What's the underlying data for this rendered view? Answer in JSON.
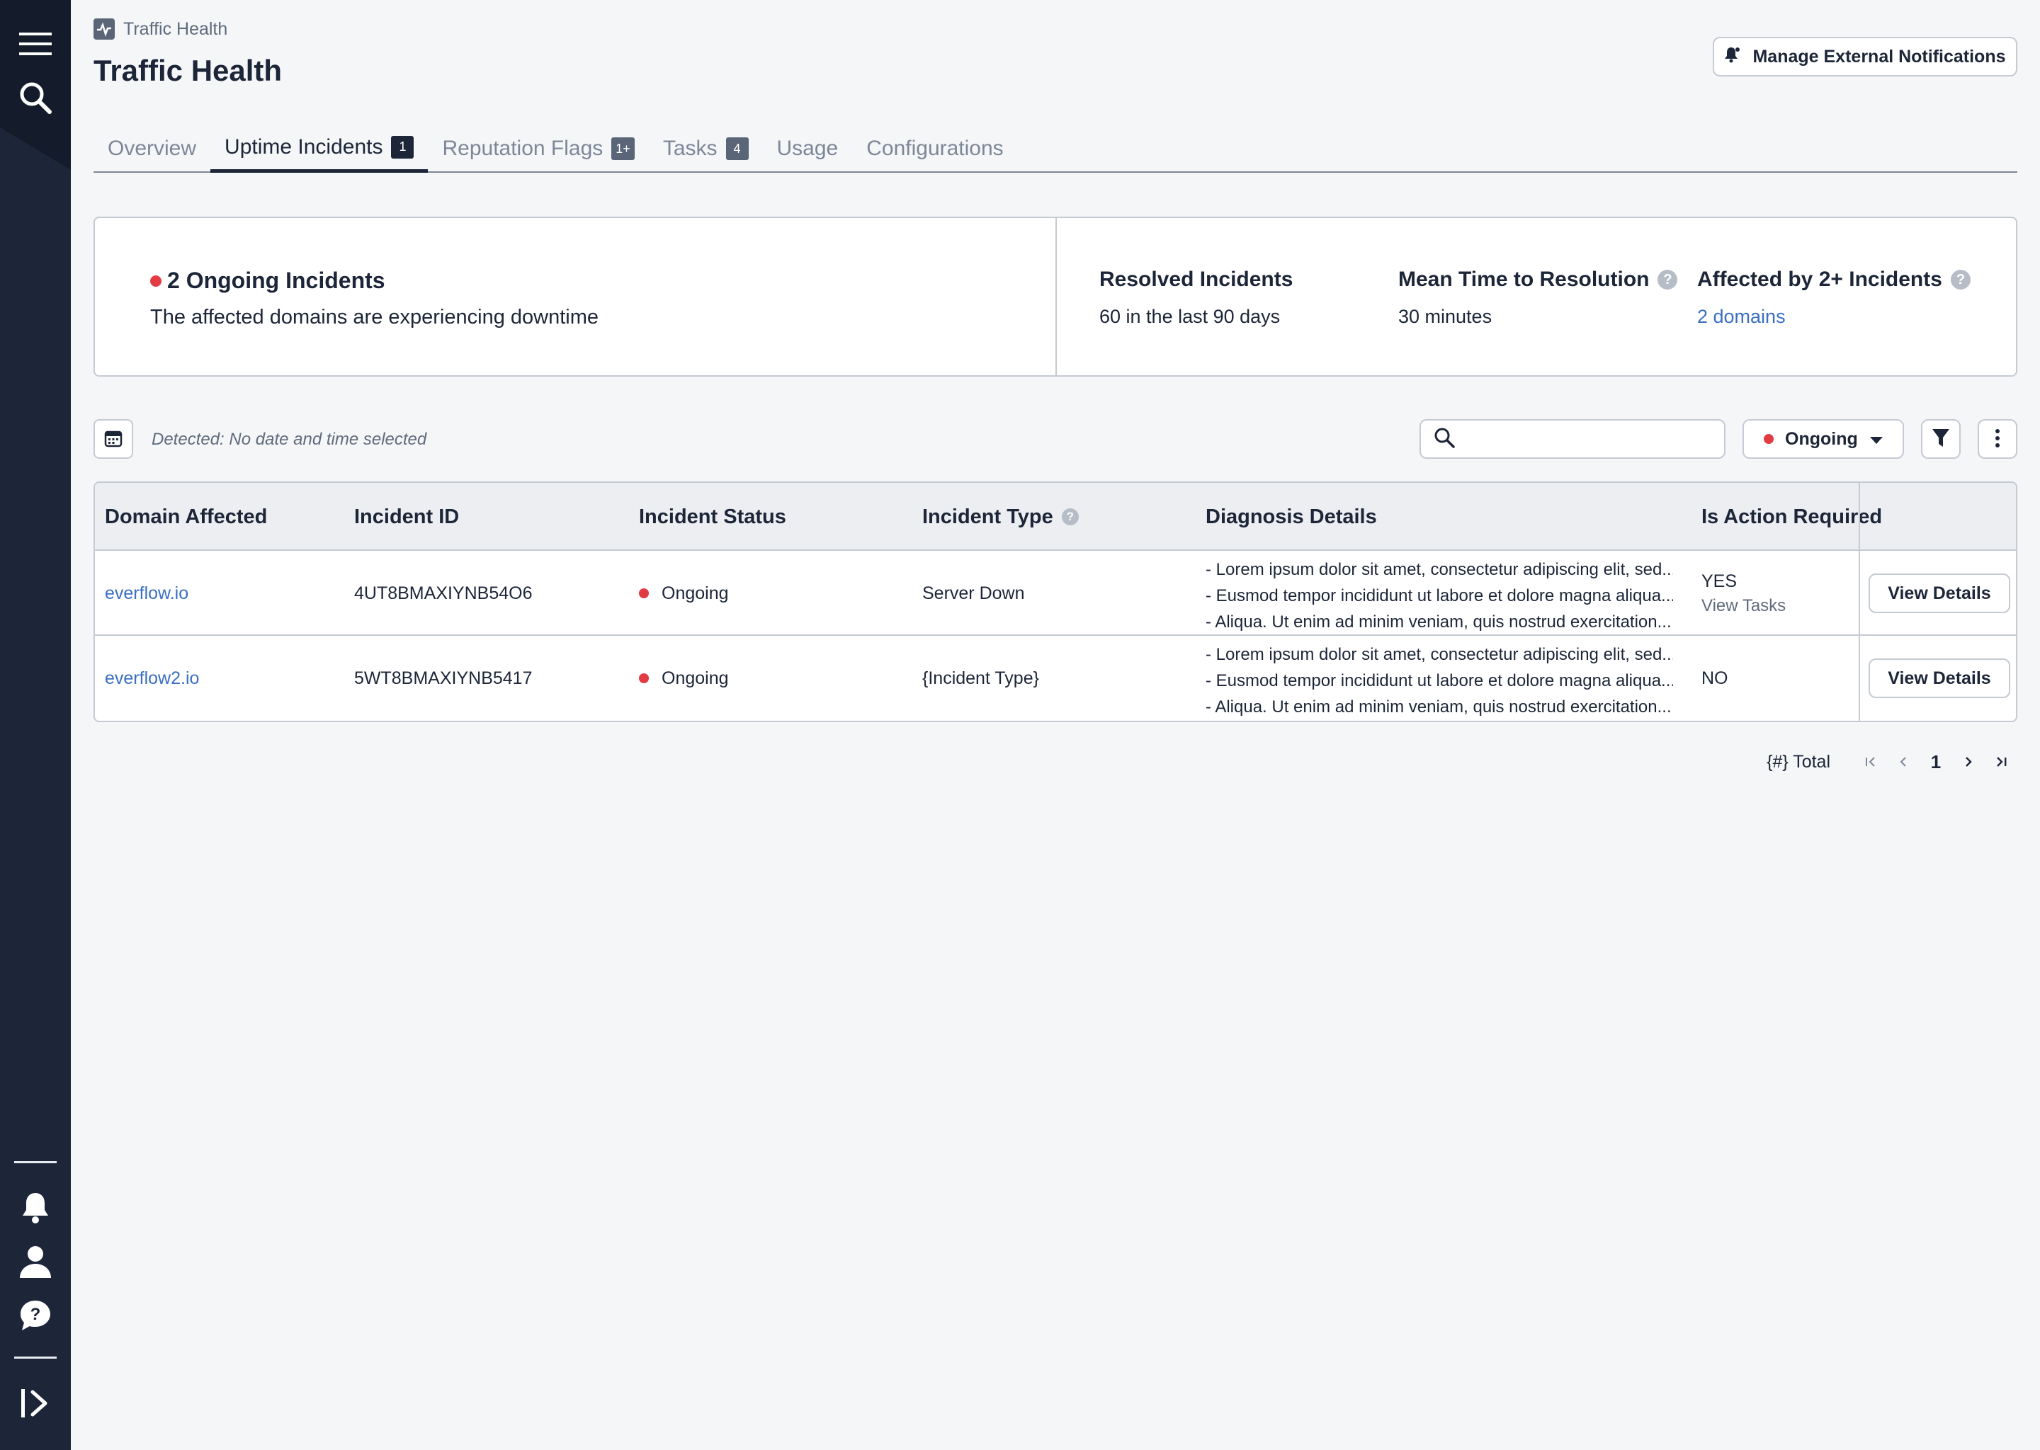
{
  "breadcrumb": {
    "label": "Traffic Health"
  },
  "page": {
    "title": "Traffic Health"
  },
  "header": {
    "manage_notifications_label": "Manage External Notifications"
  },
  "tabs": [
    {
      "label": "Overview",
      "badge": ""
    },
    {
      "label": "Uptime Incidents",
      "badge": "1"
    },
    {
      "label": "Reputation Flags",
      "badge": "1+"
    },
    {
      "label": "Tasks",
      "badge": "4"
    },
    {
      "label": "Usage",
      "badge": ""
    },
    {
      "label": "Configurations",
      "badge": ""
    }
  ],
  "summary": {
    "ongoing_title": "2 Ongoing Incidents",
    "ongoing_subtitle": "The affected domains are experiencing downtime",
    "resolved": {
      "title": "Resolved Incidents",
      "value": "60 in the last 90 days"
    },
    "mttr": {
      "title": "Mean Time to Resolution",
      "value": "30 minutes"
    },
    "affected": {
      "title": "Affected by 2+ Incidents",
      "value": "2 domains"
    }
  },
  "toolbar": {
    "detected_text": "Detected: No date and time selected",
    "search_placeholder": "",
    "status_filter": "Ongoing"
  },
  "table": {
    "headers": {
      "domain": "Domain Affected",
      "incident_id": "Incident ID",
      "status": "Incident Status",
      "type": "Incident Type",
      "diagnosis": "Diagnosis Details",
      "action": "Is Action Required"
    },
    "rows": [
      {
        "domain": "everflow.io",
        "incident_id": "4UT8BMAXIYNB54O6",
        "status": "Ongoing",
        "type": "Server Down",
        "diagnosis": [
          "- Lorem ipsum dolor sit amet, consectetur adipiscing elit, sed...",
          "- Eusmod tempor incididunt ut labore et dolore magna aliqua....",
          "- Aliqua. Ut enim ad minim veniam, quis nostrud exercitation..."
        ],
        "action": "YES",
        "action_sub": "View Tasks",
        "button": "View Details"
      },
      {
        "domain": "everflow2.io",
        "incident_id": "5WT8BMAXIYNB5417",
        "status": "Ongoing",
        "type": "{Incident Type}",
        "diagnosis": [
          "- Lorem ipsum dolor sit amet, consectetur adipiscing elit, sed...",
          "- Eusmod tempor incididunt ut labore et dolore magna aliqua....",
          "- Aliqua. Ut enim ad minim veniam, quis nostrud exercitation..."
        ],
        "action": "NO",
        "action_sub": "",
        "button": "View Details"
      }
    ]
  },
  "pagination": {
    "total": "{#} Total",
    "current_page": "1"
  },
  "colors": {
    "sidebar": "#1c2638",
    "accent_link": "#3a6fc4",
    "status_red": "#e23b44"
  },
  "icons": {
    "sidebar": [
      "menu-icon",
      "search-icon",
      "bell-icon",
      "user-icon",
      "help-chat-icon",
      "expand-sidebar-icon"
    ]
  }
}
